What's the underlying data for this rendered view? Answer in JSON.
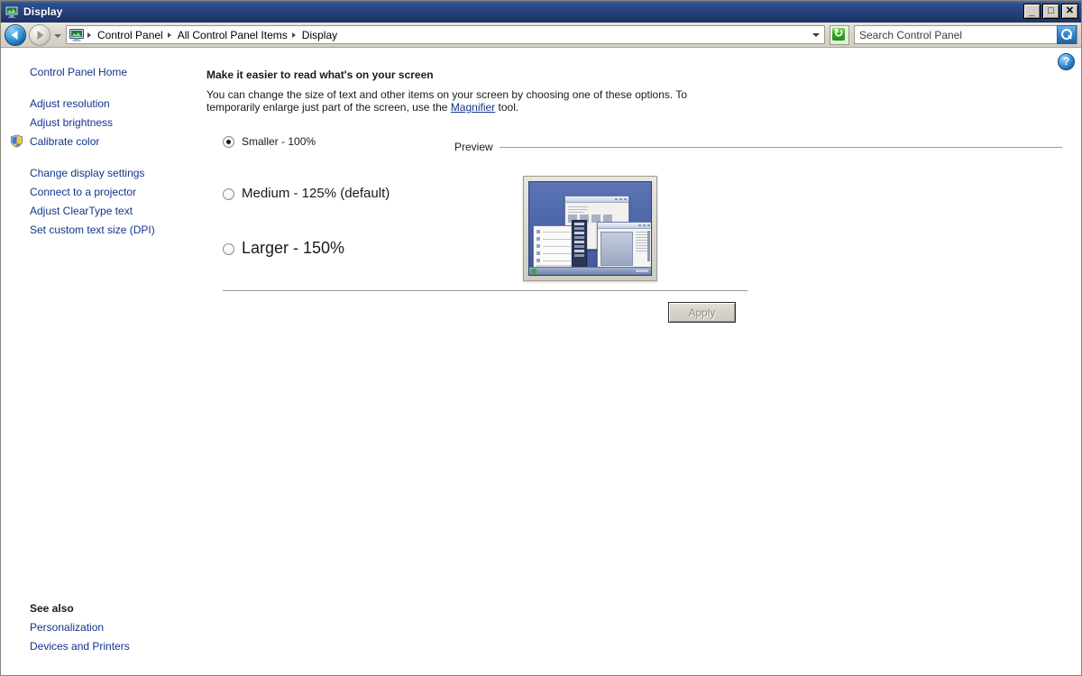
{
  "window": {
    "title": "Display",
    "icon": "display-monitor-icon",
    "buttons": {
      "minimize": "_",
      "maximize": "□",
      "close": "✕"
    }
  },
  "addressbar": {
    "back_icon": "back-arrow-icon",
    "forward_icon": "forward-arrow-icon",
    "history_icon": "chevron-down-icon",
    "breadcrumb_icon": "display-monitor-icon",
    "breadcrumbs": [
      "Control Panel",
      "All Control Panel Items",
      "Display"
    ],
    "dropdown_icon": "chevron-down-icon",
    "refresh_icon": "refresh-icon",
    "search": {
      "placeholder": "Search Control Panel",
      "value": "",
      "icon": "search-icon"
    }
  },
  "taskpane": {
    "home": "Control Panel Home",
    "items": [
      {
        "label": "Adjust resolution",
        "shield": false
      },
      {
        "label": "Adjust brightness",
        "shield": false
      },
      {
        "label": "Calibrate color",
        "shield": true
      },
      {
        "label": "Change display settings",
        "shield": false
      },
      {
        "label": "Connect to a projector",
        "shield": false
      },
      {
        "label": "Adjust ClearType text",
        "shield": false
      },
      {
        "label": "Set custom text size (DPI)",
        "shield": false
      }
    ],
    "see_also": {
      "title": "See also",
      "links": [
        "Personalization",
        "Devices and Printers"
      ]
    },
    "shield_icon": "uac-shield-icon"
  },
  "main": {
    "help_icon": "help-icon",
    "heading": "Make it easier to read what's on your screen",
    "description_before": "You can change the size of text and other items on your screen by choosing one of these options. To temporarily enlarge just part of the screen, use the ",
    "description_link": "Magnifier",
    "description_after": " tool.",
    "options": [
      {
        "label": "Smaller - 100%",
        "selected": true,
        "scale": "100"
      },
      {
        "label": "Medium - 125% (default)",
        "selected": false,
        "scale": "125"
      },
      {
        "label": "Larger - 150%",
        "selected": false,
        "scale": "150"
      }
    ],
    "preview": {
      "label": "Preview",
      "image": "desktop-preview-thumbnail"
    },
    "apply": {
      "label": "Apply",
      "enabled": false
    }
  },
  "colors": {
    "titlebar": "#26427d",
    "link": "#12348c",
    "toolbar": "#d6d2c8",
    "preview_desktop": "#4b64a8",
    "accent_green": "#35a524",
    "accent_blue": "#2f7fc4"
  }
}
